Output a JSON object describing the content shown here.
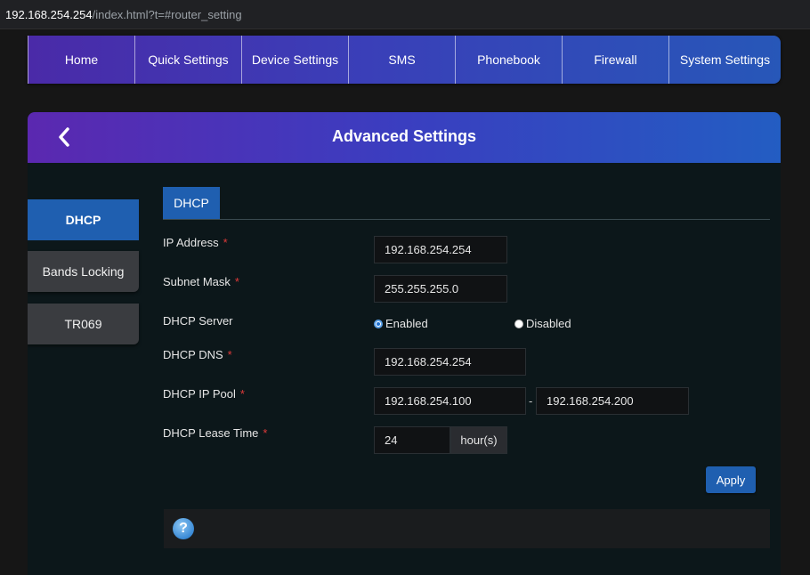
{
  "browser": {
    "url_host": "192.168.254.254",
    "url_path": "/index.html?t=#router_setting"
  },
  "nav": {
    "items": [
      {
        "label": "Home"
      },
      {
        "label": "Quick Settings"
      },
      {
        "label": "Device Settings"
      },
      {
        "label": "SMS"
      },
      {
        "label": "Phonebook"
      },
      {
        "label": "Firewall"
      },
      {
        "label": "System Settings"
      }
    ]
  },
  "panel": {
    "title": "Advanced Settings",
    "back_icon": "chevron-left-icon"
  },
  "sidebar": {
    "tabs": [
      {
        "label": "DHCP",
        "active": true
      },
      {
        "label": "Bands Locking",
        "active": false
      },
      {
        "label": "TR069",
        "active": false
      }
    ]
  },
  "dhcp": {
    "tab_label": "DHCP",
    "required_mark": "*",
    "ip_address": {
      "label": "IP Address",
      "value": "192.168.254.254"
    },
    "subnet_mask": {
      "label": "Subnet Mask",
      "value": "255.255.255.0"
    },
    "dhcp_server": {
      "label": "DHCP Server",
      "options": [
        "Enabled",
        "Disabled"
      ],
      "selected": "Enabled"
    },
    "dhcp_dns": {
      "label": "DHCP DNS",
      "value": "192.168.254.254"
    },
    "ip_pool": {
      "label": "DHCP IP Pool",
      "start": "192.168.254.100",
      "separator": "-",
      "end": "192.168.254.200"
    },
    "lease_time": {
      "label": "DHCP Lease Time",
      "value": "24",
      "unit": "hour(s)"
    },
    "apply_label": "Apply",
    "help_glyph": "?"
  },
  "colors": {
    "accent_blue": "#1f5fb0",
    "header_purple": "#5b28b0",
    "required_red": "#e03a3a",
    "panel_bg": "#0c171a"
  }
}
